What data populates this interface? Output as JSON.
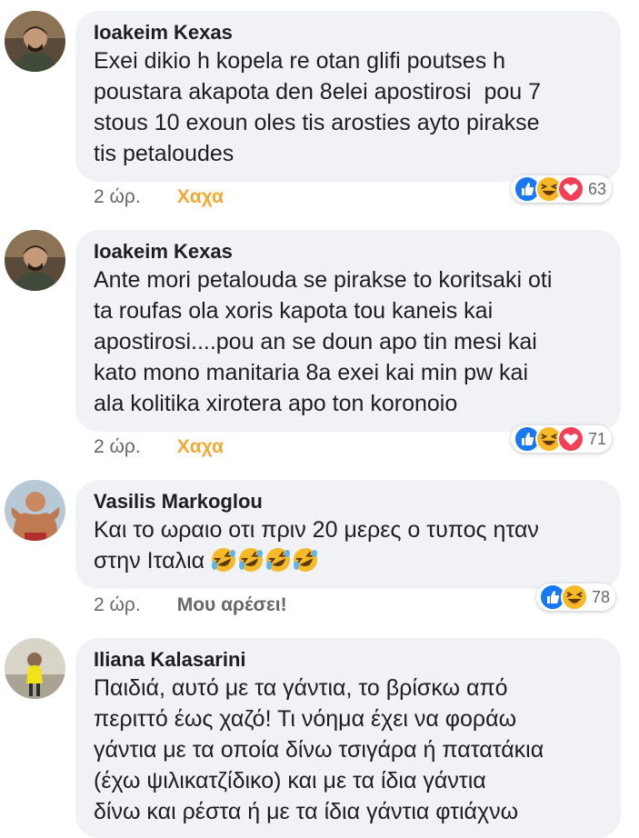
{
  "comments": [
    {
      "name": "Ioakeim Kexas",
      "text": "Exei dikio h kopela re otan glifi poutses h\npoustara akapota den 8elei apostirosi  pou 7\nstous 10 exoun oles tis arosties ayto pirakse\ntis petaloudes",
      "time": "2 ώρ.",
      "my_reaction": "Χαχα",
      "reaction_count": "63",
      "reaction_icons": [
        "like-icon",
        "haha-icon",
        "love-icon"
      ]
    },
    {
      "name": "Ioakeim Kexas",
      "text": "Ante mori petalouda se pirakse to koritsaki oti\nta roufas ola xoris kapota tou kaneis kai\napostirosi....pou an se doun apo tin mesi kai\nkato mono manitaria 8a exei kai min pw kai\nala kolitika xirotera apo ton koronoio",
      "time": "2 ώρ.",
      "my_reaction": "Χαχα",
      "reaction_count": "71",
      "reaction_icons": [
        "like-icon",
        "haha-icon",
        "love-icon"
      ]
    },
    {
      "name": "Vasilis Markoglou",
      "text_line1": "Και το ωραιο οτι πριν 20 μερες ο τυπος ηταν",
      "text_line2": "στην Ιταλια",
      "time": "2 ώρ.",
      "like_label": "Μου αρέσει!",
      "reaction_count": "78",
      "reaction_icons": [
        "like-icon",
        "haha-icon"
      ]
    },
    {
      "name": "Iliana Kalasarini",
      "text": "Παιδιά, αυτό με τα γάντια, το βρίσκω από\nπεριττό έως χαζό! Τι νόημα έχει να φοράω\nγάντια με τα οποία δίνω τσιγάρα ή πατατάκια\n(έχω ψιλικατζίδικο) και με τα ίδια γάντια\nδίνω και ρέστα ή με τα ίδια γάντια φτιάχνω"
    }
  ],
  "colors": {
    "bubble": "#f0f2f5",
    "haha_text": "#f2a931",
    "like_blue": "#1877f2",
    "love_red": "#f33e58",
    "haha_yellow": "#f7b125"
  }
}
